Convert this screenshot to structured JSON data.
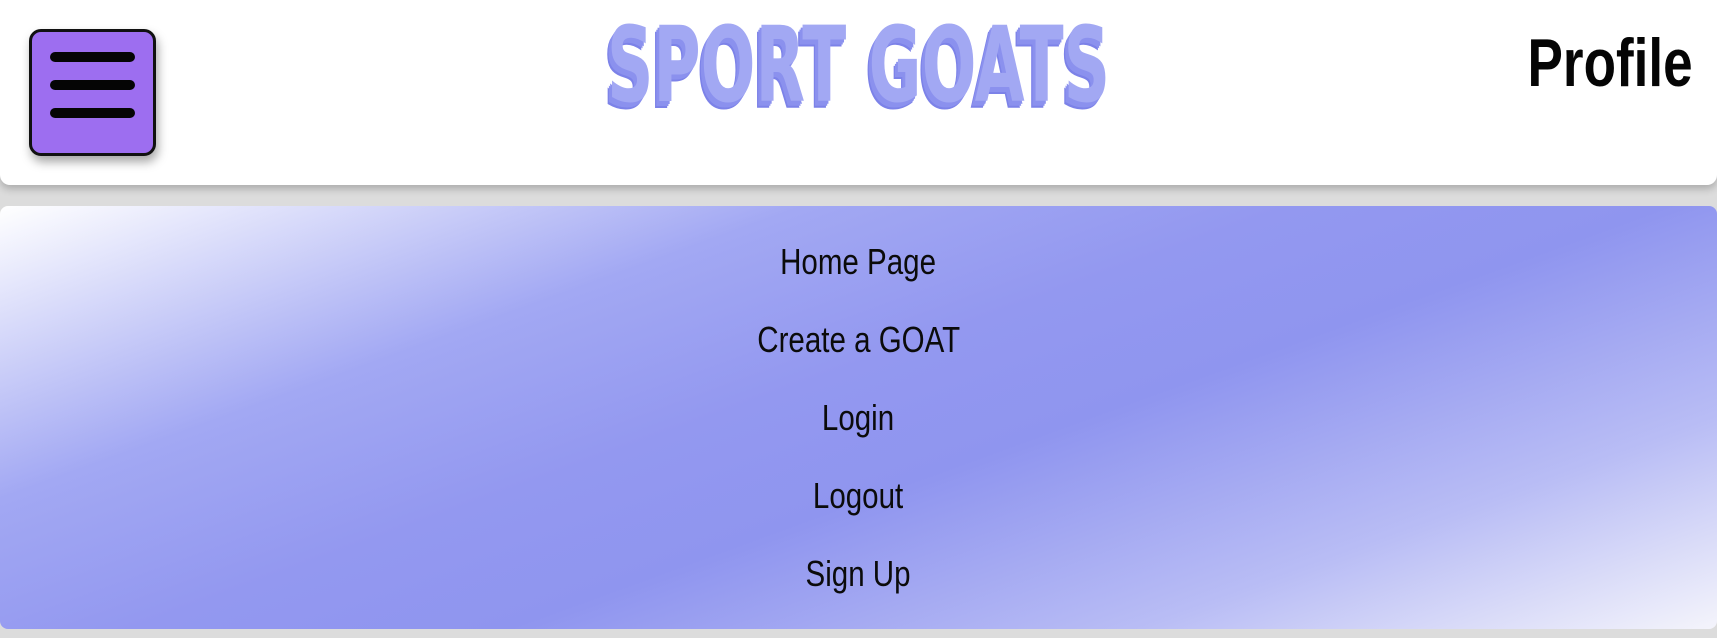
{
  "header": {
    "title": "SPORT GOATS",
    "profile_label": "Profile",
    "menu_icon": "hamburger-menu-icon"
  },
  "nav": {
    "items": [
      {
        "label": "Home Page"
      },
      {
        "label": "Create a GOAT"
      },
      {
        "label": "Login"
      },
      {
        "label": "Logout"
      },
      {
        "label": "Sign Up"
      }
    ]
  },
  "colors": {
    "title": "#a2a8f3",
    "title_shadow": "#8b91ee",
    "menu_button": "#9d6ef0",
    "nav_gradient_mid": "#9398f0",
    "header_bg": "#ffffff"
  }
}
